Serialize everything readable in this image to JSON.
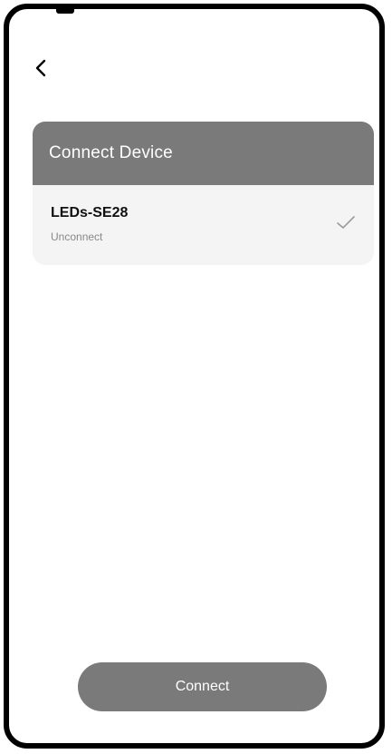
{
  "nav": {
    "back_icon": "chevron-left-icon"
  },
  "card": {
    "title": "Connect Device",
    "devices": [
      {
        "name": "LEDs-SE28",
        "status": "Unconnect",
        "selected_icon": "checkmark-icon"
      }
    ]
  },
  "footer": {
    "connect_label": "Connect"
  },
  "colors": {
    "header_bg": "#7a7a7a",
    "button_bg": "#7a7a7a",
    "row_bg": "#f4f4f4",
    "frame": "#000000"
  }
}
